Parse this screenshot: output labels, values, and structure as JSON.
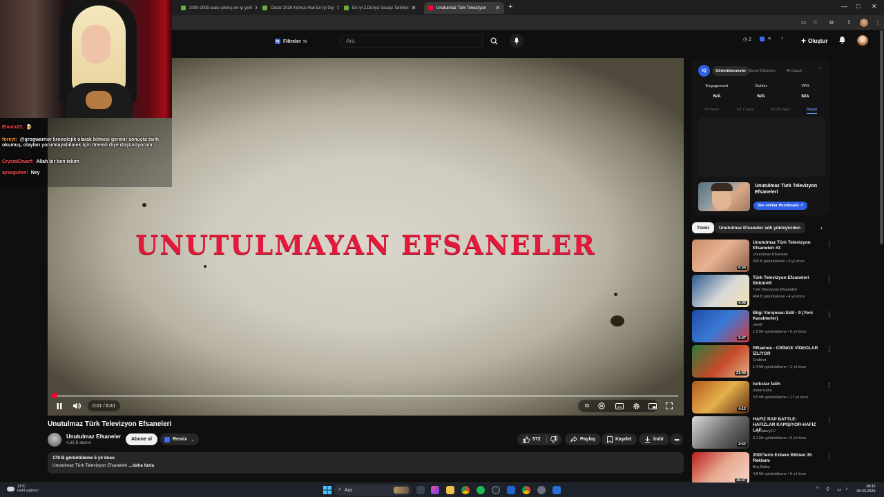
{
  "browser": {
    "tabs": [
      {
        "label": "2000-2009 arası çıkmış en iyi yerli",
        "fav": "#6cae3c"
      },
      {
        "label": "Oscar 2026 Kırmızı Halı En İyi Giy",
        "fav": "#6cae3c"
      },
      {
        "label": "En İyi 2.Dünya Savaşı Tarihleri",
        "fav": "#6cae3c"
      },
      {
        "label": "Unutulmaz Türk Televizyon",
        "fav": "#ff0033"
      }
    ],
    "new_tab": "+",
    "window_controls": [
      "—",
      "□",
      "✕"
    ]
  },
  "yt_header": {
    "filters_label": "Filtreler",
    "search_placeholder": "Ara",
    "notif_count": "2",
    "create_label": "Oluştur"
  },
  "stream": {
    "chat": [
      {
        "user": "Elavin23:",
        "text": "🍺",
        "color": "#ff4d4d"
      },
      {
        "user": "foreyt:",
        "text": "@grogwarrior kronolojik olarak bilmesi gerekir sonuçta tarih okumuş, olayları yorumlayabilmek için önemli diye düşünüyorum",
        "color": "#ff9b38"
      },
      {
        "user": "CrystalDwarf:",
        "text": "Allah bir ben tekim",
        "color": "#ff4d4d"
      },
      {
        "user": "aysegulwv:",
        "text": "Ney",
        "color": "#ff4d4d"
      }
    ]
  },
  "player": {
    "overlay_title": "UNUTULMAYAN EFSANELER",
    "time": "0:01 / 6:41",
    "progress": 0.0025
  },
  "video": {
    "title": "Unutulmaz Türk Televizyon Efsaneleri",
    "channel": "Unutulmaz Efsaneler",
    "subscribers": "4,66 B abone",
    "subscribe_label": "Abone ol",
    "remix_label": "Remix",
    "likes": "572",
    "share_label": "Paylaş",
    "save_label": "Kaydet",
    "download_label": "İndir",
    "views_line": "178 B görüntüleme  5 yıl önce",
    "desc_line": "Unutulmaz Türk Televizyon Efsaneleri ",
    "desc_more": "...daha fazla"
  },
  "vidiq": {
    "tabs": [
      "Görüntülenmeler",
      "Genel Görünüm",
      "AI Coach"
    ],
    "stats": [
      {
        "label": "Engagement",
        "value": "N/A"
      },
      {
        "label": "Outlier",
        "value": "N/A"
      },
      {
        "label": "VPH",
        "value": "N/A"
      }
    ],
    "ranges": [
      "24 hours",
      "1st 7 days",
      "1st 28 days",
      "Hepsi"
    ],
    "thumb_title": "Unutulmaz Türk Televizyon Efsaneleri",
    "thumb_button": "See similar thumbnails ↗"
  },
  "chips": [
    "Tümü",
    "Unutulmaz Efsaneler adlı yükleyiciden"
  ],
  "recommendations": [
    {
      "title": "Unutulmaz Türk Televizyon Efsaneleri  #3",
      "channel": "Unutulmaz Efsaneler",
      "meta": "260 B görüntüleme • 5 yıl önce",
      "duration": "6:50",
      "thumb": "linear-gradient(135deg,#c98b66,#e8b394 45%,#8b5e46)"
    },
    {
      "title": "Türk Televizyon Efsaneleri Bölüm#5",
      "channel": "Türk Televizyon Efsaneleri",
      "meta": "404 B görüntüleme • 4 yıl önce",
      "duration": "4:06",
      "thumb": "linear-gradient(135deg,#2a5b8e,#d9d9d9 55%,#f2e1b0)"
    },
    {
      "title": "Bilgi Yarışması Edit - 9 (Yeni Karakterler)",
      "channel": "yileHf",
      "meta": "1,5 Mn görüntüleme • 5 yıl önce",
      "duration": "3:07",
      "thumb": "linear-gradient(135deg,#1f4da8,#3c79d6 50%,#d23a3a)"
    },
    {
      "title": "RRaenee - CRİNGE VİDEOLAR İZLİYOR",
      "channel": "Craftest",
      "meta": "1,4 Mn görüntüleme • 1 yıl önce",
      "duration": "21:00",
      "thumb": "linear-gradient(135deg,#2c7a3a,#c84a2a 55%,#e0b08a)"
    },
    {
      "title": "turkstar fatih",
      "channel": "ördek baba",
      "meta": "3,5 Mn görüntüleme • 17 yıl önce",
      "duration": "4:12",
      "thumb": "linear-gradient(135deg,#b35a1f,#e6b04a 50%,#5a2a14)"
    },
    {
      "title": "HAFIZ RAP BATTLE-HAFIZLAR KAPIŞIYOR-HAFIZ LAF ...",
      "channel": "LegendaryFC",
      "meta": "3,1 Mn görüntüleme • 9 yıl önce",
      "duration": "4:52",
      "thumb": "linear-gradient(135deg,#d9d9d9,#6a6a6a 55%,#2a2a2a)"
    },
    {
      "title": "2000'lerin Ezbere Bilinen 35 Reklamı",
      "channel": "Boş Beleş",
      "meta": "4,8 Mn görüntüleme • 6 yıl önce",
      "duration": "16:37",
      "thumb": "linear-gradient(135deg,#b81d1d,#e8a890 50%,#f5d7c9)"
    }
  ],
  "taskbar": {
    "weather_temp": "11°C",
    "weather_desc": "Hafif yağmur",
    "search_label": "Ara",
    "time": "18:32",
    "date": "28.03.2026"
  }
}
